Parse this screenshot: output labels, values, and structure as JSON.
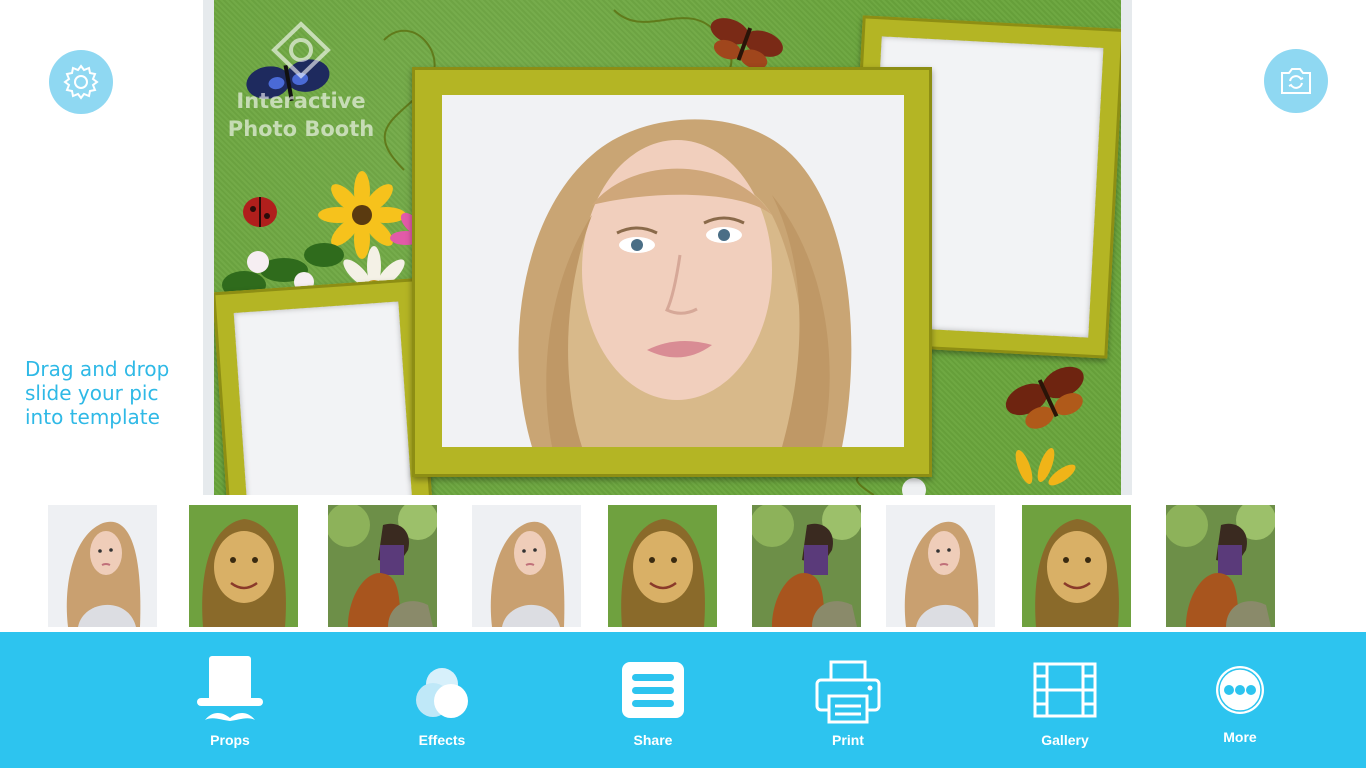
{
  "app": {
    "watermark": "Interactive\nPhoto Booth"
  },
  "top_buttons": {
    "settings_icon": "gear-icon",
    "camera_icon": "camera-switch-icon",
    "color": "#8fd8f2"
  },
  "instruction": "Drag and drop\nslide your pic\ninto template",
  "template": {
    "background": "#6aa53c",
    "frame_color": "#b4b524"
  },
  "thumbnails": [
    {
      "subject": "blonde-woman"
    },
    {
      "subject": "smiling-girl"
    },
    {
      "subject": "girl-with-dog"
    },
    {
      "subject": "blonde-woman"
    },
    {
      "subject": "smiling-girl"
    },
    {
      "subject": "girl-with-dog"
    },
    {
      "subject": "blonde-woman"
    },
    {
      "subject": "smiling-girl"
    },
    {
      "subject": "girl-with-dog"
    }
  ],
  "toolbar": {
    "color": "#2dc4ef",
    "items": [
      {
        "label": "Props",
        "icon": "top-hat-mustache-icon"
      },
      {
        "label": "Effects",
        "icon": "effects-circles-icon"
      },
      {
        "label": "Share",
        "icon": "share-stack-icon"
      },
      {
        "label": "Print",
        "icon": "printer-icon"
      },
      {
        "label": "Gallery",
        "icon": "film-strip-icon"
      },
      {
        "label": "More",
        "icon": "more-dots-icon"
      }
    ]
  }
}
